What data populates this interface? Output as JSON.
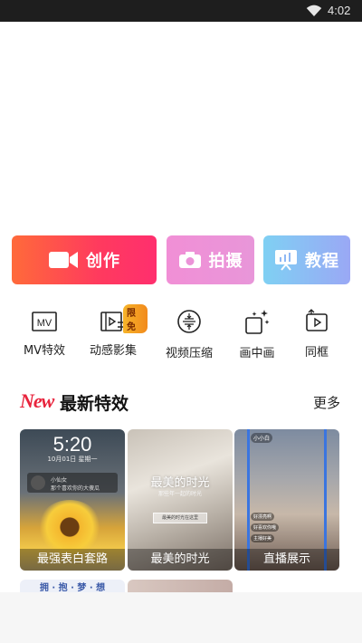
{
  "status_bar": {
    "time": "4:02",
    "icons": [
      "wifi-icon"
    ]
  },
  "actions": {
    "create_label": "创作",
    "shoot_label": "拍摄",
    "tutorial_label": "教程",
    "icons": [
      "video-camera-icon",
      "camera-icon",
      "presentation-icon"
    ]
  },
  "tools": [
    {
      "label": "MV特效",
      "icon": "mv-icon"
    },
    {
      "label": "动感影集",
      "icon": "film-album-icon",
      "badge": "限免"
    },
    {
      "label": "视频压缩",
      "icon": "compress-icon"
    },
    {
      "label": "画中画",
      "icon": "picture-in-picture-icon"
    },
    {
      "label": "同框",
      "icon": "same-frame-icon"
    }
  ],
  "section": {
    "badge": "New",
    "title": "最新特效",
    "more": "更多"
  },
  "cards": [
    {
      "caption": "最强表白套路",
      "time": "5:20",
      "date": "10月01日 星期一",
      "msg_line1": "小仙女",
      "msg_line2": "那个喜欢你的大傻瓜"
    },
    {
      "caption": "最美的时光",
      "overlay_title": "最美的时光",
      "overlay_sub": "那些年一起的时光",
      "box_text": "最美的时光在这里"
    },
    {
      "caption": "直播展示",
      "tag": "小小白",
      "bubbles": [
        "好漂亮啊",
        "好喜欢你哦",
        "主播好美"
      ]
    }
  ],
  "row2": [
    {
      "text": "拥 · 抱 · 梦 · 想"
    },
    {
      "text": ""
    }
  ],
  "colors": {
    "accent": "#ff3a5e",
    "new_red": "#e8233c",
    "pip_blue": "#3a75e0"
  }
}
